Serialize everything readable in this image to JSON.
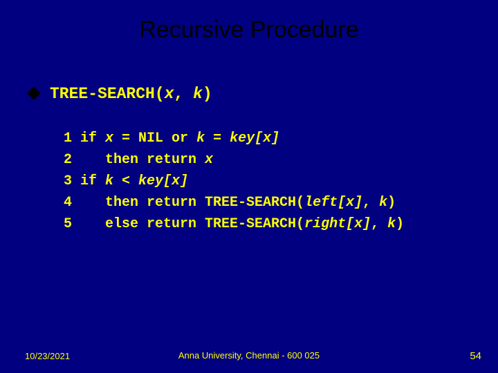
{
  "title": "Recursive Procedure",
  "heading": {
    "proc": "TREE-SEARCH(",
    "arg1": "x",
    "sep": ", ",
    "arg2": "k",
    "close": ")"
  },
  "code": {
    "l1_num": "1 if ",
    "l1_i1": "x",
    "l1_mid1": " = NIL or ",
    "l1_i2": "k",
    "l1_mid2": " = ",
    "l1_i3": "key[x]",
    "l2_num": "2    then return ",
    "l2_i1": "x",
    "l3_num": "3 if ",
    "l3_i1": "k",
    "l3_mid1": " < ",
    "l3_i2": "key[x]",
    "l4_num": "4    then return TREE-SEARCH(",
    "l4_i1": "left[x]",
    "l4_mid": ", ",
    "l4_i2": "k",
    "l4_close": ")",
    "l5_num": "5    else return TREE-SEARCH(",
    "l5_i1": "right[x]",
    "l5_mid": ", ",
    "l5_i2": "k",
    "l5_close": ")"
  },
  "footer": {
    "date": "10/23/2021",
    "center": "Anna University, Chennai - 600 025",
    "page": "54"
  }
}
